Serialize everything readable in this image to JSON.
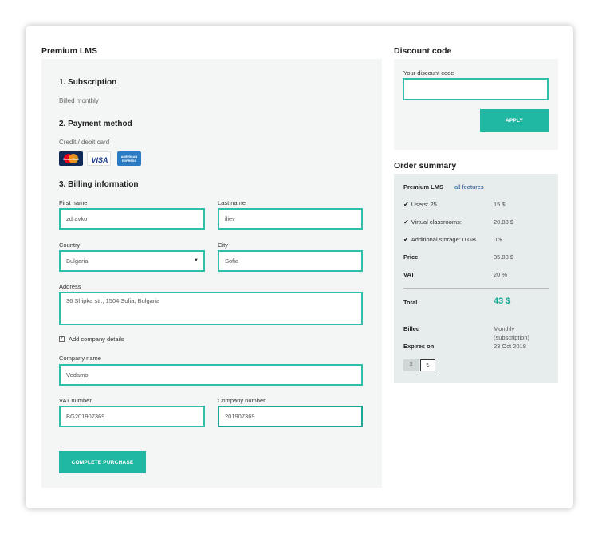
{
  "product": {
    "title": "Premium LMS"
  },
  "subscription": {
    "heading": "1. Subscription",
    "billing": "Billed monthly"
  },
  "payment": {
    "heading": "2. Payment method",
    "method": "Credit / debit card",
    "cards": [
      "mastercard",
      "visa",
      "american-express"
    ],
    "mastercard_text": "MasterCard",
    "visa_text": "VISA",
    "amex_text_1": "AMERICAN",
    "amex_text_2": "EXPRESS"
  },
  "billing": {
    "heading": "3. Billing information",
    "first_name_label": "First name",
    "first_name": "zdravko",
    "last_name_label": "Last name",
    "last_name": "iliev",
    "country_label": "Country",
    "country": "Bulgaria",
    "city_label": "City",
    "city": "Sofia",
    "address_label": "Address",
    "address": "36 Shipka str., 1504 Sofia, Bulgaria",
    "company_details_label": "Add company details",
    "company_name_label": "Company name",
    "company_name": "Vedamo",
    "vat_label": "VAT number",
    "vat": "BG201907369",
    "company_number_label": "Company number",
    "company_number": "201907369",
    "submit_label": "COMPLETE PURCHASE"
  },
  "discount": {
    "title": "Discount code",
    "input_label": "Your discount code",
    "input_value": "",
    "apply_label": "APPLY"
  },
  "summary": {
    "title": "Order summary",
    "plan": "Premium LMS",
    "features_link": "all features",
    "users_label": "Users: 25",
    "users_value": "15 $",
    "classrooms_label": "Virtual classrooms:",
    "classrooms_value": "20.83 $",
    "storage_label": "Additional storage: 0 GB",
    "storage_value": "0 $",
    "price_label": "Price",
    "price_value": "35.83 $",
    "vat_label": "VAT",
    "vat_value": "20 %",
    "total_label": "Total",
    "total_value": "43 $",
    "billed_label": "Billed",
    "billed_value_1": "Monthly",
    "billed_value_2": "(subscription)",
    "expires_label": "Expires on",
    "expires_value": "23 Oct 2018",
    "currency_usd": "$",
    "currency_eur": "€"
  },
  "colors": {
    "accent": "#20b8a2",
    "total": "#1aa893",
    "panel": "#f4f5f5",
    "summary": "#e7ecec"
  }
}
